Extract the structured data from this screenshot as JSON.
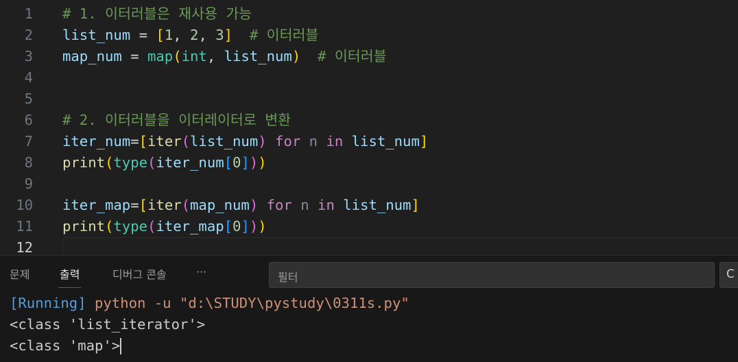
{
  "editor": {
    "current_line": 12,
    "lines": [
      {
        "n": "1",
        "tokens": [
          [
            "# 1. 이터러블은 재사용 가능",
            "cm"
          ]
        ]
      },
      {
        "n": "2",
        "tokens": [
          [
            "list_num",
            "v"
          ],
          [
            " = ",
            "op"
          ],
          [
            "[",
            "b1"
          ],
          [
            "1",
            "num"
          ],
          [
            ", ",
            "op"
          ],
          [
            "2",
            "num"
          ],
          [
            ", ",
            "op"
          ],
          [
            "3",
            "num"
          ],
          [
            "]",
            "b1"
          ],
          [
            "  # 이터러블",
            "cm"
          ]
        ]
      },
      {
        "n": "3",
        "tokens": [
          [
            "map_num",
            "v"
          ],
          [
            " = ",
            "op"
          ],
          [
            "map",
            "cls"
          ],
          [
            "(",
            "b1"
          ],
          [
            "int",
            "cls"
          ],
          [
            ", ",
            "op"
          ],
          [
            "list_num",
            "v"
          ],
          [
            ")",
            "b1"
          ],
          [
            "  # 이터러블",
            "cm"
          ]
        ]
      },
      {
        "n": "4",
        "tokens": []
      },
      {
        "n": "5",
        "tokens": []
      },
      {
        "n": "6",
        "tokens": [
          [
            "# 2. 이터러블을 이터레이터로 변환",
            "cm"
          ]
        ]
      },
      {
        "n": "7",
        "tokens": [
          [
            "iter_num",
            "v"
          ],
          [
            "=",
            "op"
          ],
          [
            "[",
            "b1"
          ],
          [
            "iter",
            "fn"
          ],
          [
            "(",
            "b2"
          ],
          [
            "list_num",
            "v"
          ],
          [
            ")",
            "b2"
          ],
          [
            " for ",
            "kw"
          ],
          [
            "n",
            "un"
          ],
          [
            " in ",
            "kw"
          ],
          [
            "list_num",
            "v"
          ],
          [
            "]",
            "b1"
          ]
        ]
      },
      {
        "n": "8",
        "tokens": [
          [
            "print",
            "fn"
          ],
          [
            "(",
            "b1"
          ],
          [
            "type",
            "cls"
          ],
          [
            "(",
            "b2"
          ],
          [
            "iter_num",
            "v"
          ],
          [
            "[",
            "b3"
          ],
          [
            "0",
            "num"
          ],
          [
            "]",
            "b3"
          ],
          [
            ")",
            "b2"
          ],
          [
            ")",
            "b1"
          ]
        ]
      },
      {
        "n": "9",
        "tokens": []
      },
      {
        "n": "10",
        "tokens": [
          [
            "iter_map",
            "v"
          ],
          [
            "=",
            "op"
          ],
          [
            "[",
            "b1"
          ],
          [
            "iter",
            "fn"
          ],
          [
            "(",
            "b2"
          ],
          [
            "map_num",
            "v"
          ],
          [
            ")",
            "b2"
          ],
          [
            " for ",
            "kw"
          ],
          [
            "n",
            "un"
          ],
          [
            " in ",
            "kw"
          ],
          [
            "list_num",
            "v"
          ],
          [
            "]",
            "b1"
          ]
        ]
      },
      {
        "n": "11",
        "tokens": [
          [
            "print",
            "fn"
          ],
          [
            "(",
            "b1"
          ],
          [
            "type",
            "cls"
          ],
          [
            "(",
            "b2"
          ],
          [
            "iter_map",
            "v"
          ],
          [
            "[",
            "b3"
          ],
          [
            "0",
            "num"
          ],
          [
            "]",
            "b3"
          ],
          [
            ")",
            "b2"
          ],
          [
            ")",
            "b1"
          ]
        ]
      },
      {
        "n": "12",
        "tokens": []
      }
    ]
  },
  "panel": {
    "tabs": [
      "문제",
      "출력",
      "디버그 콘솔"
    ],
    "more": "···",
    "filter_placeholder": "필터",
    "extra_button": "C",
    "output": {
      "running": "[Running]",
      "command": " python -u \"d:\\STUDY\\pystudy\\0311s.py\"",
      "lines": [
        "<class 'list_iterator'>",
        "<class 'map'>"
      ]
    }
  }
}
